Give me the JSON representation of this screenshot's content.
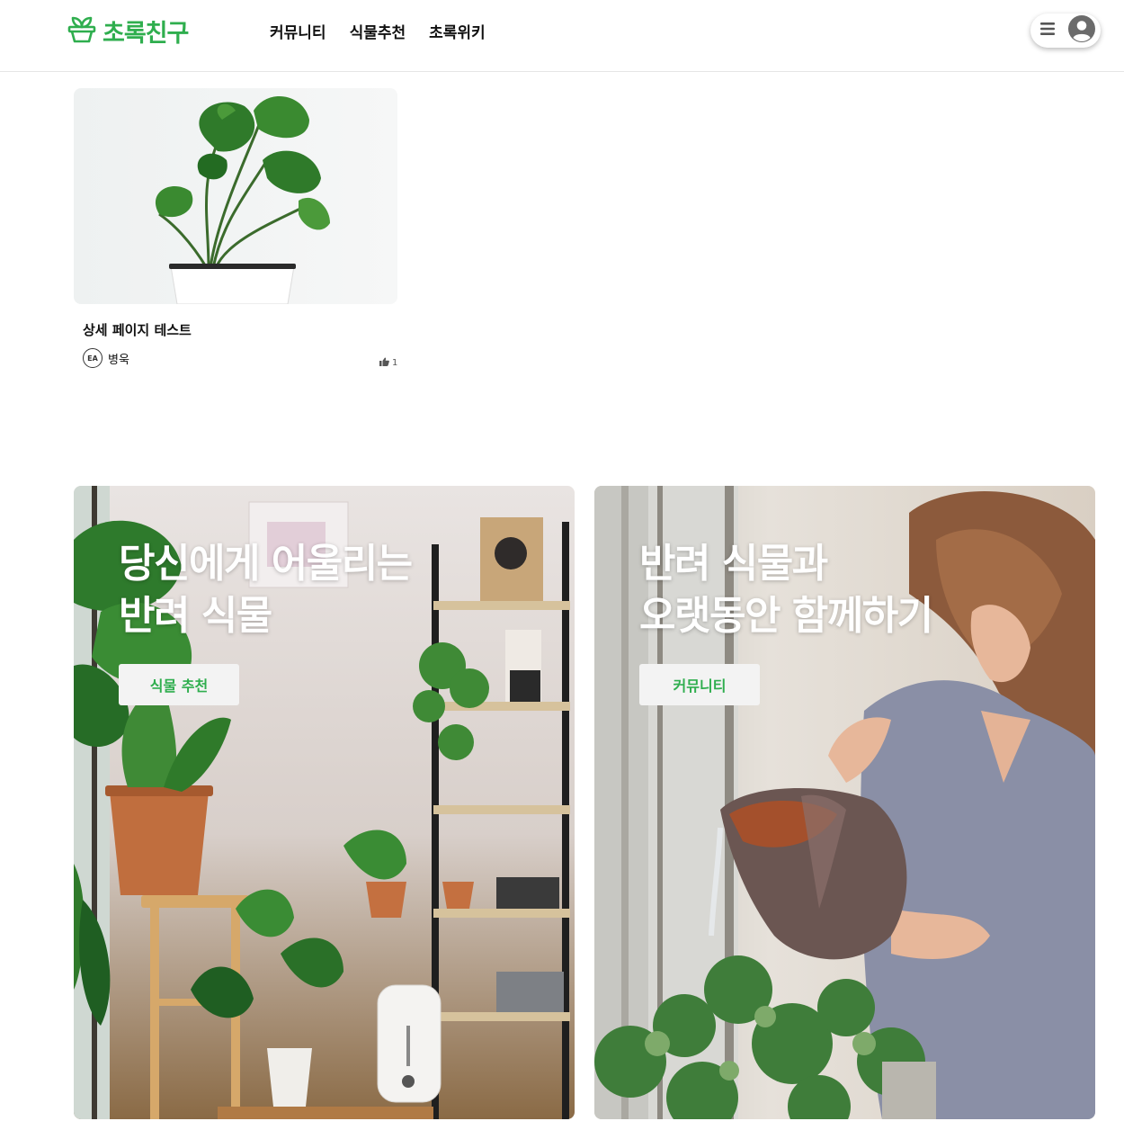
{
  "header": {
    "logo_text": "초록친구",
    "logo_icon": "plant-pot-icon",
    "nav": [
      {
        "label": "커뮤니티"
      },
      {
        "label": "식물추천"
      },
      {
        "label": "초록위키"
      }
    ],
    "user_menu": {
      "menu_icon": "hamburger-icon",
      "avatar_icon": "user-circle-icon"
    }
  },
  "posts": [
    {
      "title": "상세 페이지 테스트",
      "author": {
        "name": "병욱",
        "avatar_text": "EA"
      },
      "likes": "1",
      "like_icon": "thumbs-up-icon",
      "thumbnail": "monstera-plant-image"
    }
  ],
  "banners": [
    {
      "heading_line1": "당신에게 어울리는",
      "heading_line2": "반려 식물",
      "button_label": "식물 추천",
      "image": "plant-shelf-room-image"
    },
    {
      "heading_line1": "반려 식물과",
      "heading_line2": "오랫동안 함께하기",
      "button_label": "커뮤니티",
      "image": "woman-watering-plants-image"
    }
  ],
  "colors": {
    "brand": "#2fae4e",
    "button_bg": "#f3f3f3",
    "border": "#e6e6e6"
  }
}
